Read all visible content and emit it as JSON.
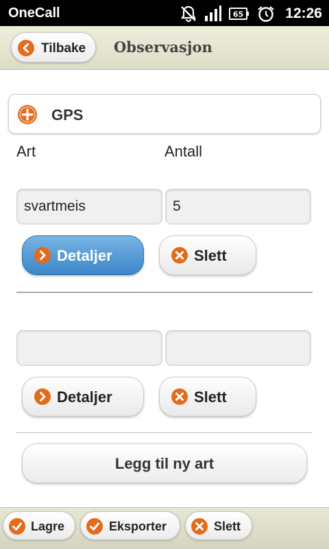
{
  "status_bar": {
    "carrier": "OneCall",
    "battery_level": "65",
    "time": "12:26",
    "icons": [
      "notifications-muted-icon",
      "signal-icon",
      "battery-icon",
      "alarm-icon"
    ]
  },
  "header": {
    "back_label": "Tilbake",
    "title": "Observasjon"
  },
  "gps": {
    "label": "GPS"
  },
  "columns": {
    "species": "Art",
    "count": "Antall"
  },
  "entries": [
    {
      "species_value": "svartmeis",
      "count_value": "5",
      "details_label": "Detaljer",
      "delete_label": "Slett",
      "details_active": true
    },
    {
      "species_value": "",
      "count_value": "",
      "details_label": "Detaljer",
      "delete_label": "Slett",
      "details_active": false
    }
  ],
  "add_species_label": "Legg til ny art",
  "footer": {
    "save_label": "Lagre",
    "export_label": "Eksporter",
    "delete_label": "Slett"
  },
  "colors": {
    "accent_orange": "#e36b1c",
    "primary_blue": "#3c86c8",
    "status_bar": "#000000"
  }
}
